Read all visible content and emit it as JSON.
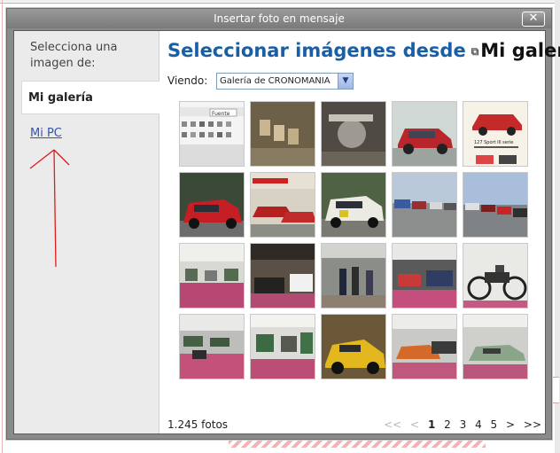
{
  "dialog": {
    "title": "Insertar foto en mensaje",
    "close_label": "✕"
  },
  "sidebar": {
    "heading": "Selecciona una imagen de:",
    "items": [
      {
        "label": "Mi galería",
        "active": true
      },
      {
        "label": "Mi PC",
        "active": false
      }
    ]
  },
  "main": {
    "title": "Seleccionar imágenes desde",
    "title_icon": "popup-icon",
    "title_gallery": "Mi galería",
    "viewing_label": "Viendo:",
    "viewing_value": "Galería de CRONOMANIA",
    "photo_count": "1.245 fotos",
    "thumbnails": [
      {
        "name": "editor-toolbar",
        "label": "Fuente"
      },
      {
        "name": "engine-parts"
      },
      {
        "name": "mechanical-part"
      },
      {
        "name": "red-hatchback-side"
      },
      {
        "name": "car-advert",
        "label": "127 Sport III serie"
      },
      {
        "name": "red-rally-car"
      },
      {
        "name": "red-cars-poster"
      },
      {
        "name": "white-rally-car"
      },
      {
        "name": "parked-cars-row"
      },
      {
        "name": "cars-parking-lot"
      },
      {
        "name": "exhibition-hall-pink"
      },
      {
        "name": "exhibition-stands"
      },
      {
        "name": "exhibition-visitors"
      },
      {
        "name": "exhibition-market"
      },
      {
        "name": "vintage-motorcycle"
      },
      {
        "name": "hall-overview"
      },
      {
        "name": "hall-stands-green"
      },
      {
        "name": "yellow-sports-car"
      },
      {
        "name": "orange-classic-car"
      },
      {
        "name": "green-classic-car"
      }
    ]
  },
  "pagination": {
    "first": "<<",
    "prev": "<",
    "pages": [
      "1",
      "2",
      "3",
      "4",
      "5"
    ],
    "current": "1",
    "next": ">",
    "last": ">>"
  },
  "colors": {
    "title_blue": "#1a5fa5",
    "link_blue": "#3355aa",
    "annotation_red": "#dd1c1c",
    "dialog_gray": "#8a8a8a"
  }
}
